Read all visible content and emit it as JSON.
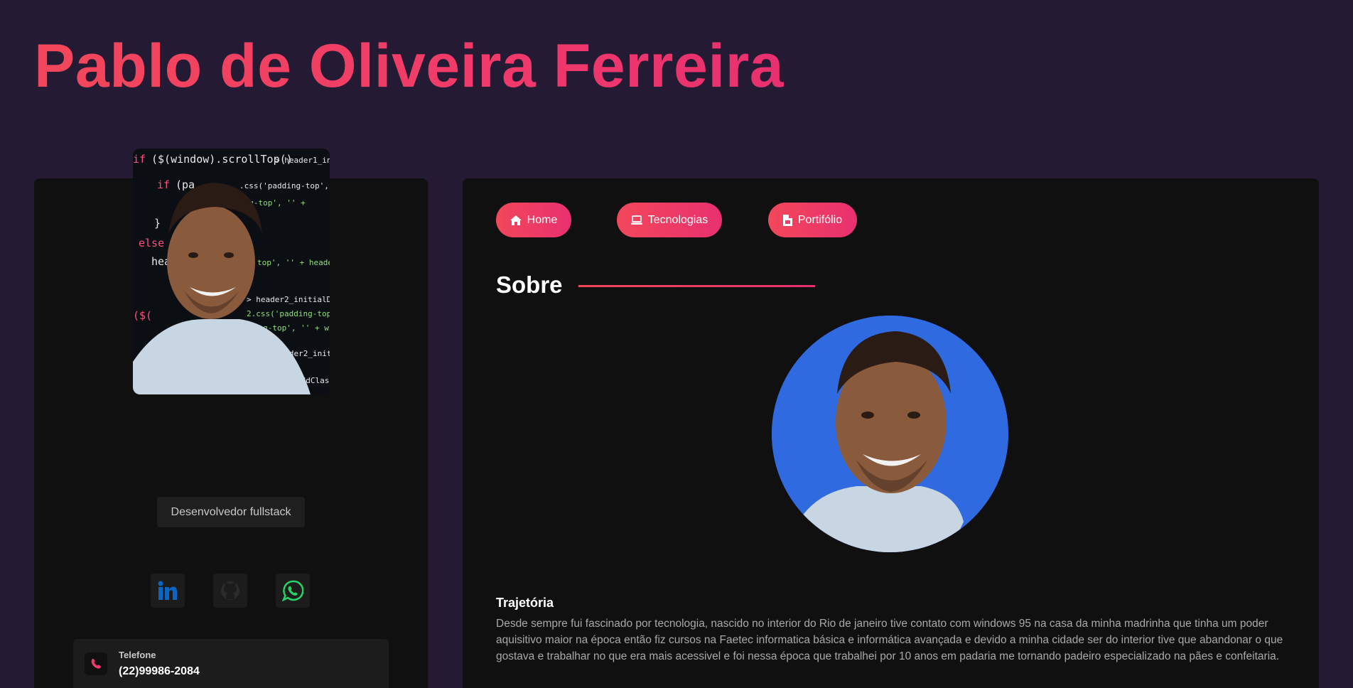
{
  "header": {
    "title": "Pablo de Oliveira Ferreira"
  },
  "profile": {
    "role": "Desenvolvedor fullstack",
    "social": [
      {
        "name": "linkedin",
        "icon": "linkedin-icon",
        "color": "#0a66c2"
      },
      {
        "name": "github",
        "icon": "github-icon",
        "color": "#2b2b2b"
      },
      {
        "name": "whatsapp",
        "icon": "whatsapp-icon",
        "color": "#25d366"
      }
    ],
    "contact": {
      "label": "Telefone",
      "value": "(22)99986-2084",
      "icon": "phone-icon"
    }
  },
  "nav": {
    "items": [
      {
        "label": "Home",
        "icon": "home-icon"
      },
      {
        "label": "Tecnologias",
        "icon": "laptop-icon"
      },
      {
        "label": "Portifólio",
        "icon": "file-icon"
      }
    ]
  },
  "about": {
    "title": "Sobre",
    "trajectory_title": "Trajetória",
    "trajectory_text": "Desde sempre fui fascinado por tecnologia, nascido no interior do Rio de janeiro tive contato com windows 95 na casa da minha madrinha que tinha um poder aquisitivo maior na época então fiz cursos na Faetec informatica básica e informática avançada e devido a minha cidade ser do interior tive que abandonar o que gostava e trabalhar no que era mais acessivel e foi nessa época que trabalhei por 10 anos em padaria me tornando padeiro especializado na pães e confeitaria."
  },
  "colors": {
    "background": "#251a33",
    "card": "#101010",
    "accent_start": "#f2475a",
    "accent_end": "#e8306f"
  }
}
